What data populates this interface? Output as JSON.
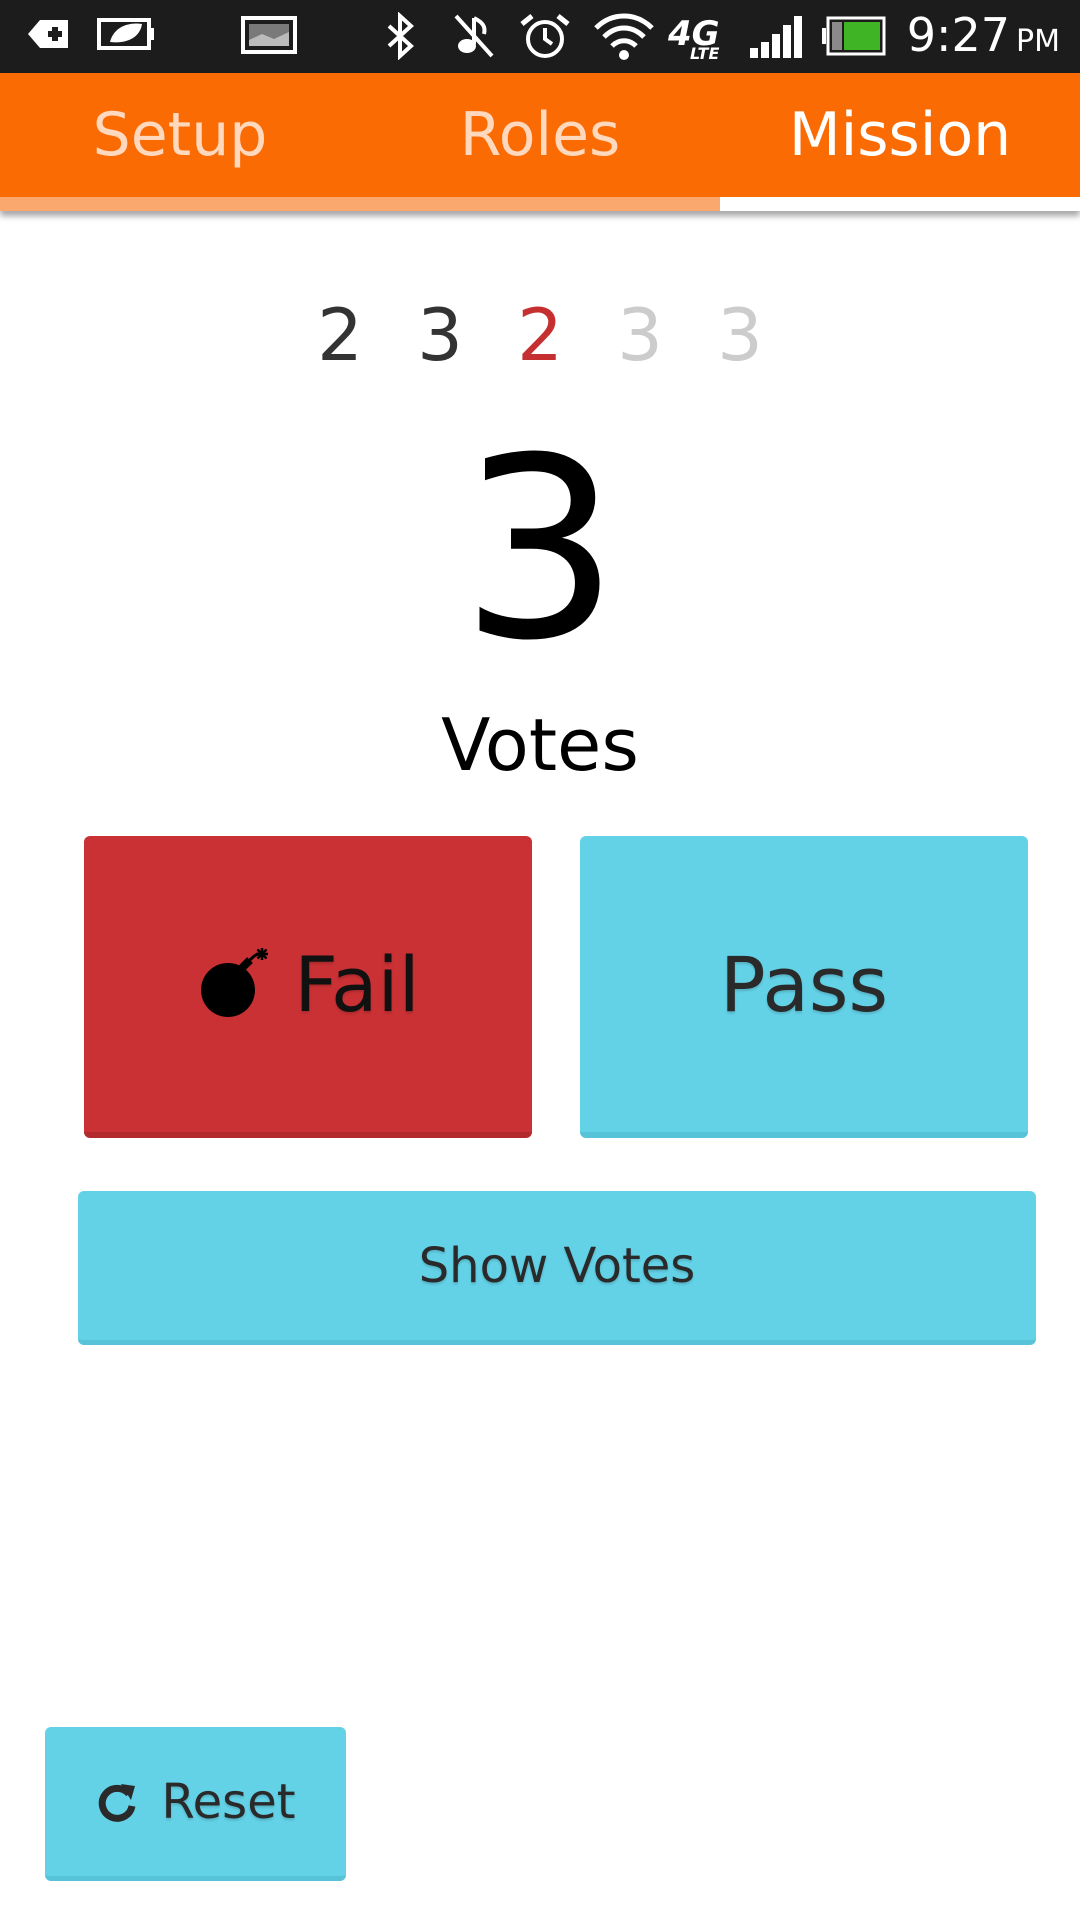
{
  "status_bar": {
    "icons": [
      "usb-debug-icon",
      "power-saver-icon",
      "image-notification-icon",
      "bluetooth-icon",
      "muted-icon",
      "alarm-icon",
      "wifi-icon",
      "4g-lte-icon",
      "signal-icon",
      "battery-icon"
    ],
    "network_label": "4G",
    "network_sub": "LTE",
    "time": "9:27",
    "ampm": "PM"
  },
  "tabs": [
    {
      "label": "Setup",
      "active": false
    },
    {
      "label": "Roles",
      "active": false
    },
    {
      "label": "Mission",
      "active": true
    }
  ],
  "rounds": [
    {
      "value": "2",
      "state": "done"
    },
    {
      "value": "3",
      "state": "done"
    },
    {
      "value": "2",
      "state": "failed"
    },
    {
      "value": "3",
      "state": "upcoming"
    },
    {
      "value": "3",
      "state": "upcoming"
    }
  ],
  "vote_count": "3",
  "votes_label": "Votes",
  "buttons": {
    "fail": "Fail",
    "pass": "Pass",
    "show_votes": "Show Votes",
    "reset": "Reset"
  },
  "colors": {
    "accent": "#fb6b04",
    "fail": "#c93134",
    "pass": "#63d1e6",
    "failed_round": "#c62f30",
    "upcoming_round": "#cccccc"
  }
}
